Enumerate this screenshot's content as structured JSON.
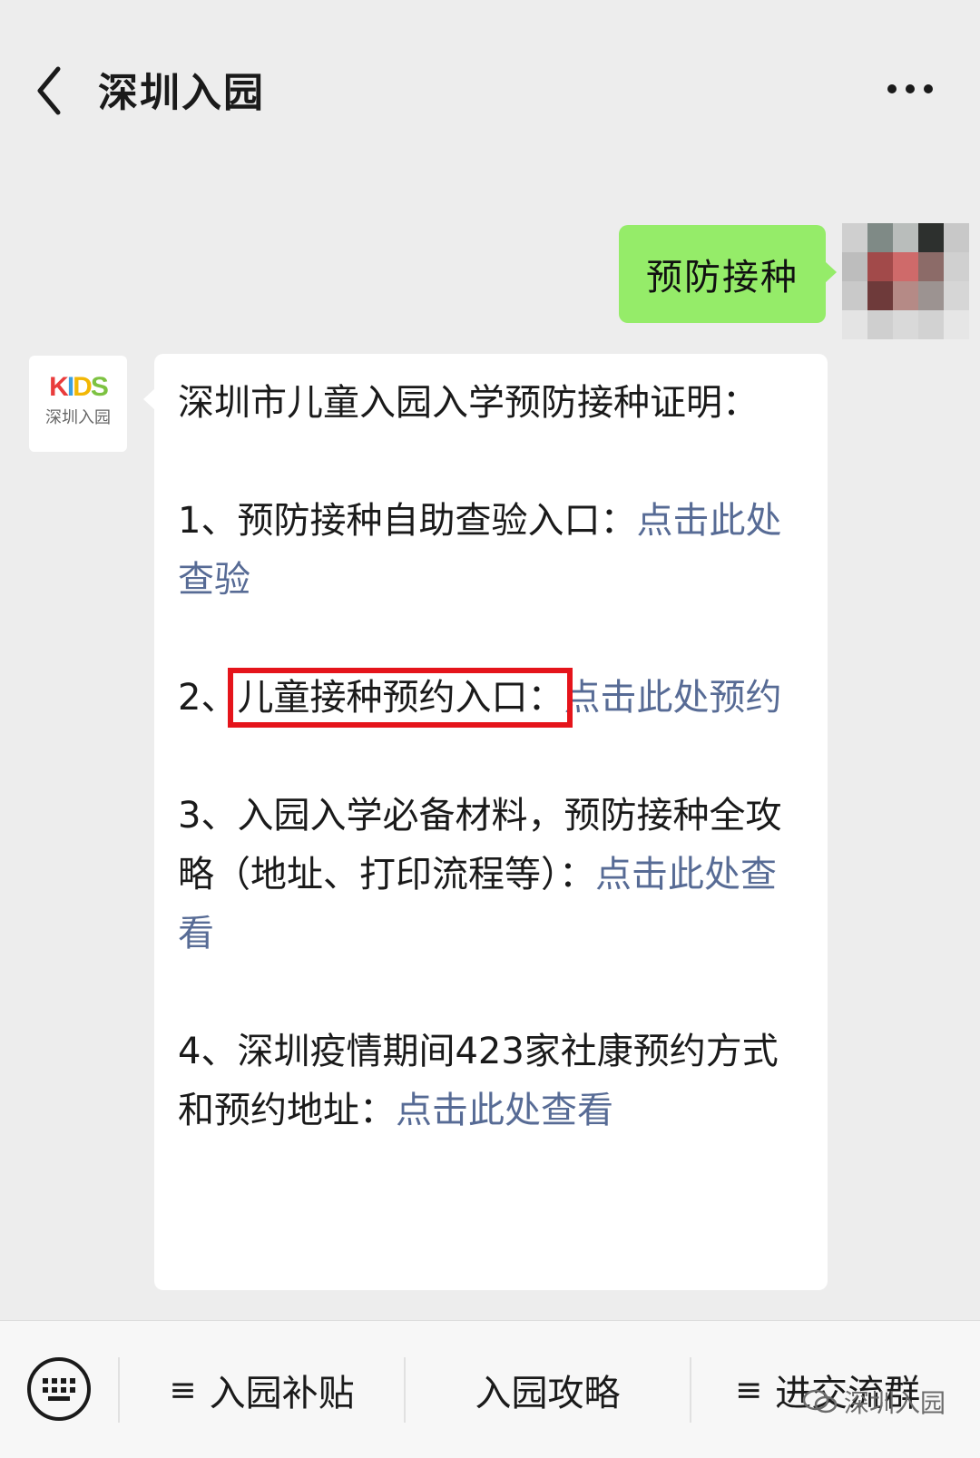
{
  "header": {
    "title": "深圳入园",
    "back_icon": "chevron-left-icon",
    "more_icon": "ellipsis-icon"
  },
  "outgoing_message": {
    "text": "预防接种"
  },
  "bot": {
    "avatar_logo": "KIDS",
    "avatar_brand": "深圳入园"
  },
  "incoming_message": {
    "intro": "深圳市儿童入园入学预防接种证明：",
    "items": [
      {
        "prefix": "1、",
        "text": "预防接种自助查验入口：",
        "link": "点击此处查验"
      },
      {
        "prefix": "2、",
        "text": "儿童接种预约入口：",
        "link": "点击此处预约"
      },
      {
        "prefix": "3、",
        "text": "入园入学必备材料，预防接种全攻略（地址、打印流程等）：",
        "link": "点击此处查看"
      },
      {
        "prefix": "4、",
        "text": "深圳疫情期间423家社康预约方式和预约地址：",
        "link": "点击此处查看"
      }
    ]
  },
  "bottom_menu": {
    "keyboard_icon": "keyboard-icon",
    "items": [
      {
        "label": "入园补贴",
        "has_menu": true
      },
      {
        "label": "入园攻略",
        "has_menu": false
      },
      {
        "label": "进交流群",
        "has_menu": true
      }
    ],
    "hamburger_symbol": "≡"
  },
  "watermark": "深圳入园",
  "colors": {
    "bubble_out": "#95ec69",
    "link": "#576b95",
    "highlight_box": "#e5141b",
    "background": "#ededed"
  }
}
